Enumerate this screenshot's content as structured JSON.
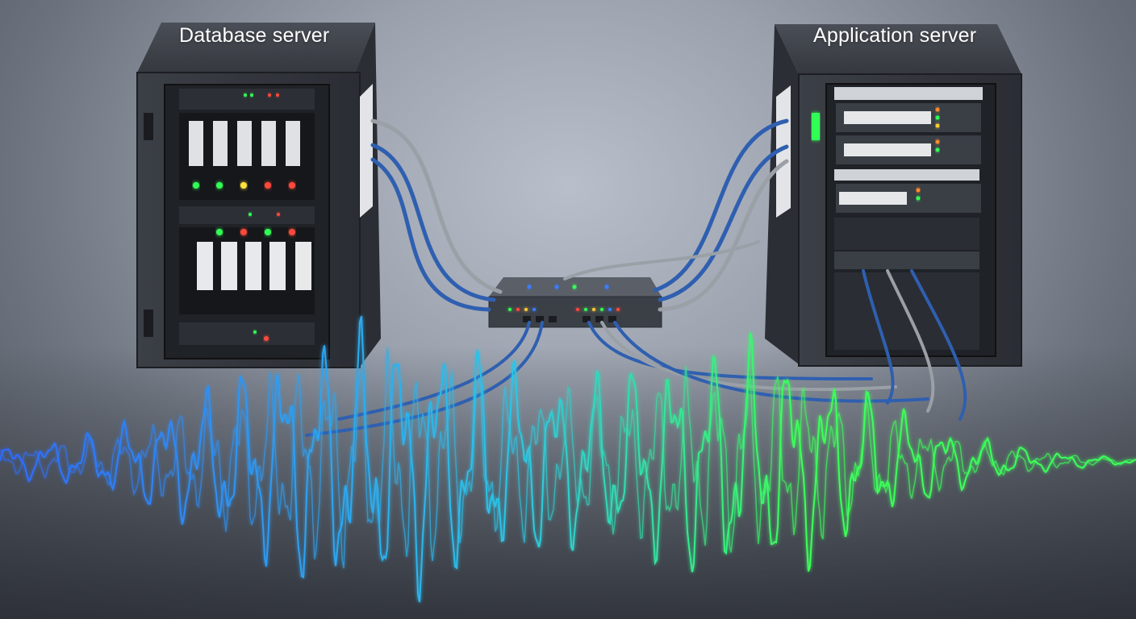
{
  "labels": {
    "database_server": "Database server",
    "application_server": "Application server"
  },
  "colors": {
    "background": "#9aa1ad",
    "wave_left": "#2f6bff",
    "wave_mid": "#2cc6e8",
    "wave_right": "#3cff5a",
    "cable_blue": "#2f5fb0",
    "cable_grey": "#9aa0a6",
    "led_green": "#33ff55",
    "led_red": "#ff4a3a",
    "led_blue": "#3a7dff"
  },
  "icons": [
    "database-server-rack",
    "application-server-rack",
    "network-switch",
    "signal-waveform"
  ]
}
